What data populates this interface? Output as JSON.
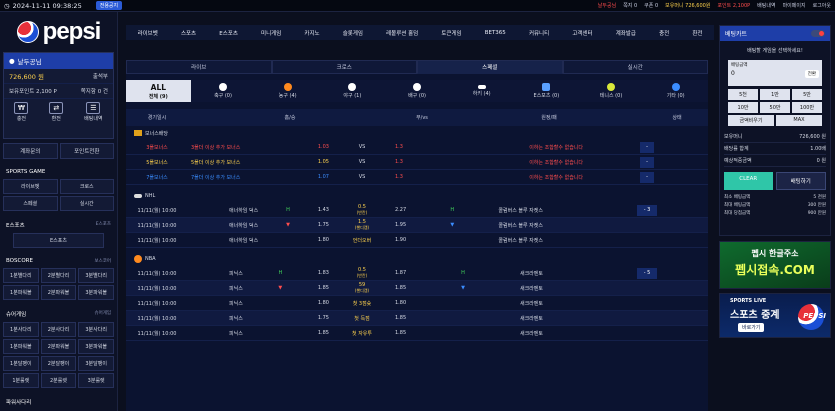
{
  "topbar": {
    "time": "2024-11-11 09:38:25",
    "notice_label": "전용공지",
    "links": [
      "날두공님",
      "쪽지 0",
      "쿠폰 0",
      "보유머니 726,600원",
      "포인트 2,100P",
      "배팅내역",
      "마이페이지",
      "로그아웃"
    ]
  },
  "logo": {
    "text": "pepsi"
  },
  "user": {
    "name": "날두공님",
    "money": "726,600 원",
    "points": "보유포인트 2,100 P",
    "btn_deposit": "충전",
    "btn_withdraw": "환전",
    "btn_history": "배팅내역",
    "side_labels": [
      "출석부",
      "쪽지함",
      "0 건"
    ],
    "link_account": "계좌문의",
    "link_point": "포인트전환"
  },
  "sidebar": {
    "sports_title": "SPORTS GAME",
    "sports_btns": [
      "라이브벳",
      "크로스",
      "스페셜",
      "실시간"
    ],
    "esports_title": "E스포츠",
    "esports_sub": "E스포츠",
    "esports_btn": "E스포츠",
    "boscore_title": "BOSCORE",
    "boscore_sub": "보스코어",
    "boscore_btns": [
      "1분별다리",
      "2분별다리",
      "3분별다리",
      "1분파워볼",
      "2분파워볼",
      "3분파워볼"
    ],
    "sure_title": "슈어게임",
    "sure_sub": "슈어게임",
    "sure_btns": [
      "1분사다리",
      "2분사다리",
      "3분사다리",
      "1분파워볼",
      "2분파워볼",
      "3분파워볼",
      "1분달팽이",
      "2분달팽이",
      "3분달팽이",
      "1분룰렛",
      "2분룰렛",
      "3분룰렛"
    ],
    "power_title": "파워사다리"
  },
  "mainnav": [
    "라이브벳",
    "스포츠",
    "E스포츠",
    "미니게임",
    "카지노",
    "슬롯게임",
    "레볼루션 홀덤",
    "토큰게임",
    "BET365",
    "커뮤니티",
    "고객센터",
    "계좌발급",
    "충전",
    "환전"
  ],
  "tabs": [
    "라이브",
    "크로스",
    "스페셜",
    "실시간"
  ],
  "sports_filter": [
    {
      "label": "ALL",
      "sub": "전체 (9)",
      "color": "#ffffff"
    },
    {
      "label": "축구 (0)",
      "color": "#ffffff"
    },
    {
      "label": "농구 (4)",
      "color": "#ff8a1f"
    },
    {
      "label": "야구 (1)",
      "color": "#ffffff"
    },
    {
      "label": "배구 (0)",
      "color": "#ffffff"
    },
    {
      "label": "하키 (4)",
      "color": "#ffffff"
    },
    {
      "label": "E스포츠 (0)",
      "color": "#5aa0ff"
    },
    {
      "label": "테니스 (0)",
      "color": "#d8e83a"
    },
    {
      "label": "기타 (0)",
      "color": "#3b8dff"
    }
  ],
  "table_head": [
    "경기일시",
    "홈/승",
    "무/vs",
    "원정/패",
    "상태"
  ],
  "bonus": {
    "title": "보너스배당",
    "rows": [
      {
        "name": "3폴보너스",
        "cond": "3폴더 이상 추가 보너스",
        "odd": "1.03",
        "vs": "VS",
        "odd2": "1.3",
        "cond2": "이하는 조합할수 없습니다",
        "color": "#ff4d4d",
        "selected": false
      },
      {
        "name": "5폴보너스",
        "cond": "5폴더 이상 추가 보너스",
        "odd": "1.05",
        "vs": "VS",
        "odd2": "1.3",
        "cond2": "이하는 조합할수 없습니다",
        "color": "#ffd34d",
        "selected": false
      },
      {
        "name": "7폴보너스",
        "cond": "7폴더 이상 추가 보너스",
        "odd": "1.07",
        "vs": "VS",
        "odd2": "1.3",
        "cond2": "이하는 조합할수 없습니다",
        "color": "#3b8dff",
        "selected": false
      }
    ]
  },
  "leagues": [
    {
      "name": "NHL",
      "rows": [
        {
          "date": "11/11(월) 10:00",
          "home": "애너하임 덕스",
          "hm": "H",
          "odd1": "1.43",
          "mid": "0.5",
          "midsub": "(반칸)",
          "odd2": "2.27",
          "am": "H",
          "away": "콜럼버스 블루 자켓스",
          "btn": "- 3"
        },
        {
          "date": "11/11(월) 10:00",
          "home": "애너하임 덕스",
          "hm": "▼",
          "odd1": "1.75",
          "mid": "1.5",
          "midsub": "(핸디캡)",
          "odd2": "1.95",
          "am": "▼",
          "away": "콜럼버스 블루 자켓스",
          "btn": ""
        },
        {
          "date": "11/11(월) 10:00",
          "home": "애너하임 덕스",
          "hm": "",
          "odd1": "1.80",
          "mid": "언더오버",
          "midsub": "",
          "odd2": "1.90",
          "am": "",
          "away": "콜럼버스 블루 자켓스",
          "btn": ""
        }
      ]
    },
    {
      "name": "NBA",
      "rows": [
        {
          "date": "11/11(월) 10:00",
          "home": "피닉스",
          "hm": "H",
          "odd1": "1.83",
          "mid": "0.5",
          "midsub": "(반칸)",
          "odd2": "1.87",
          "am": "H",
          "away": "새크라멘토",
          "btn": "- 5"
        },
        {
          "date": "11/11(월) 10:00",
          "home": "피닉스",
          "hm": "▼",
          "odd1": "1.85",
          "mid": "59",
          "midsub": "(핸디캡)",
          "odd2": "1.85",
          "am": "▼",
          "away": "새크라멘토",
          "btn": ""
        },
        {
          "date": "11/11(월) 10:00",
          "home": "피닉스",
          "hm": "",
          "odd1": "1.80",
          "mid": "첫 3점슛",
          "midsub": "",
          "odd2": "1.80",
          "am": "",
          "away": "새크라멘토",
          "btn": ""
        },
        {
          "date": "11/11(월) 10:00",
          "home": "피닉스",
          "hm": "",
          "odd1": "1.75",
          "mid": "첫 득점",
          "midsub": "",
          "odd2": "1.85",
          "am": "",
          "away": "새크라멘토",
          "btn": ""
        },
        {
          "date": "11/11(월) 10:00",
          "home": "피닉스",
          "hm": "",
          "odd1": "1.85",
          "mid": "첫 자유투",
          "midsub": "",
          "odd2": "1.85",
          "am": "",
          "away": "새크라멘토",
          "btn": ""
        }
      ]
    }
  ],
  "betslip": {
    "title": "베팅카트",
    "message": "배팅할 게임을 선택하세요!",
    "amount_label": "배팅금액",
    "amount_value": "0",
    "amount_btn": "전환",
    "chips": [
      "5천",
      "1만",
      "5만",
      "10만",
      "50만",
      "100만"
    ],
    "chips2": [
      "금액비우기",
      "MAX"
    ],
    "info": [
      {
        "k": "보유머니",
        "v": "726,600 원"
      },
      {
        "k": "배당률 합계",
        "v": "1.00배"
      },
      {
        "k": "예상적중금액",
        "v": "0 원"
      }
    ],
    "clear_label": "CLEAR",
    "place_label": "배팅하기",
    "limits": [
      {
        "k": "최소 배팅금액",
        "v": "5 천원"
      },
      {
        "k": "최대 배팅금액",
        "v": "300 만원"
      },
      {
        "k": "최대 당첨금액",
        "v": "900 만원"
      }
    ]
  },
  "banner1": {
    "t1": "펩시 한글주소",
    "t2": "펩시접속.COM"
  },
  "banner2": {
    "t1": "SPORTS LIVE",
    "t2": "스포츠 중계",
    "t3": "바로가기",
    "logo": "PEPSI"
  }
}
